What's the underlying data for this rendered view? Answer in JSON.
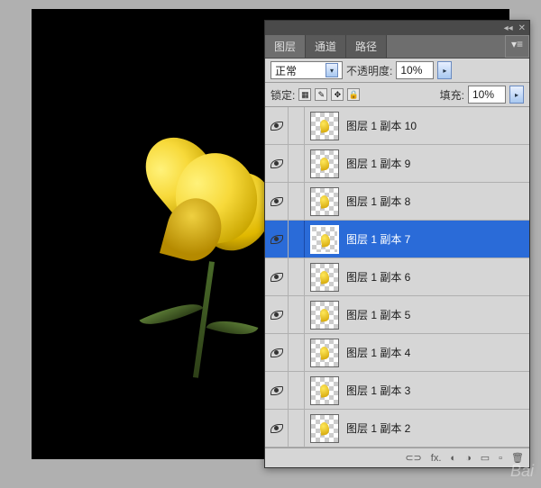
{
  "tabs": {
    "layers": "图层",
    "channels": "通道",
    "paths": "路径"
  },
  "blend": {
    "mode": "正常",
    "opacity_label": "不透明度:",
    "opacity_value": "10%"
  },
  "lock": {
    "label": "锁定:",
    "fill_label": "填充:",
    "fill_value": "10%"
  },
  "layers": [
    {
      "name": "图层 1 副本 10",
      "selected": false
    },
    {
      "name": "图层 1 副本 9",
      "selected": false
    },
    {
      "name": "图层 1 副本 8",
      "selected": false
    },
    {
      "name": "图层 1 副本 7",
      "selected": true
    },
    {
      "name": "图层 1 副本 6",
      "selected": false
    },
    {
      "name": "图层 1 副本 5",
      "selected": false
    },
    {
      "name": "图层 1 副本 4",
      "selected": false
    },
    {
      "name": "图层 1 副本 3",
      "selected": false
    },
    {
      "name": "图层 1 副本 2",
      "selected": false
    }
  ],
  "bottombar": {
    "link": "⊂⊃",
    "fx": "fx.",
    "mask": "◐",
    "adj": "◑",
    "folder": "▭",
    "new": "▫",
    "trash": "🗑"
  },
  "watermark": "Bai"
}
